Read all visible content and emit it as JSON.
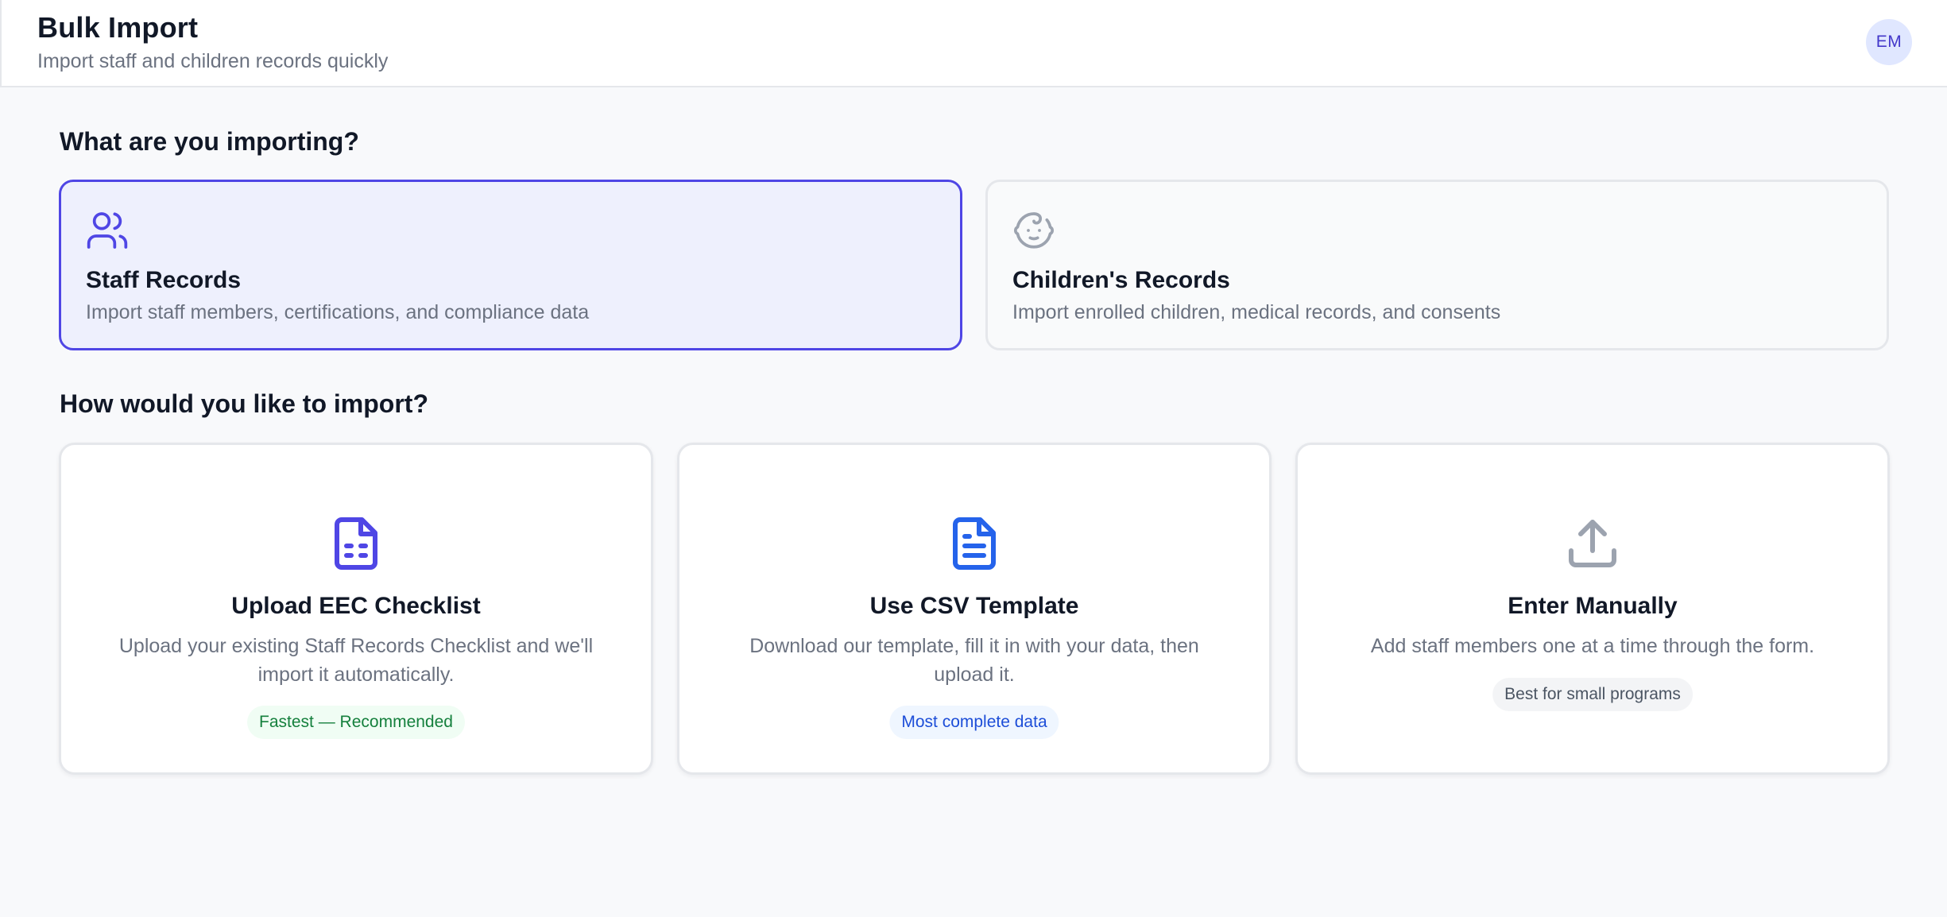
{
  "header": {
    "title": "Bulk Import",
    "subtitle": "Import staff and children records quickly",
    "avatar_initials": "EM"
  },
  "sections": {
    "type_heading": "What are you importing?",
    "method_heading": "How would you like to import?"
  },
  "import_types": [
    {
      "title": "Staff Records",
      "description": "Import staff members, certifications, and compliance data",
      "icon": "users-icon",
      "selected": true
    },
    {
      "title": "Children's Records",
      "description": "Import enrolled children, medical records, and consents",
      "icon": "baby-icon",
      "selected": false
    }
  ],
  "import_methods": [
    {
      "title": "Upload EEC Checklist",
      "description": "Upload your existing Staff Records Checklist and we'll import it automatically.",
      "badge": "Fastest — Recommended",
      "icon": "file-spreadsheet-icon",
      "accent": "#4f46e5"
    },
    {
      "title": "Use CSV Template",
      "description": "Download our template, fill it in with your data, then upload it.",
      "badge": "Most complete data",
      "icon": "file-text-icon",
      "accent": "#2563eb"
    },
    {
      "title": "Enter Manually",
      "description": "Add staff members one at a time through the form.",
      "badge": "Best for small programs",
      "icon": "upload-icon",
      "accent": "#9ca3af"
    }
  ],
  "colors": {
    "primary": "#4f46e5",
    "selected_bg": "#eef0fd",
    "badge_green_text": "#15803d",
    "badge_blue_text": "#1d4ed8"
  }
}
